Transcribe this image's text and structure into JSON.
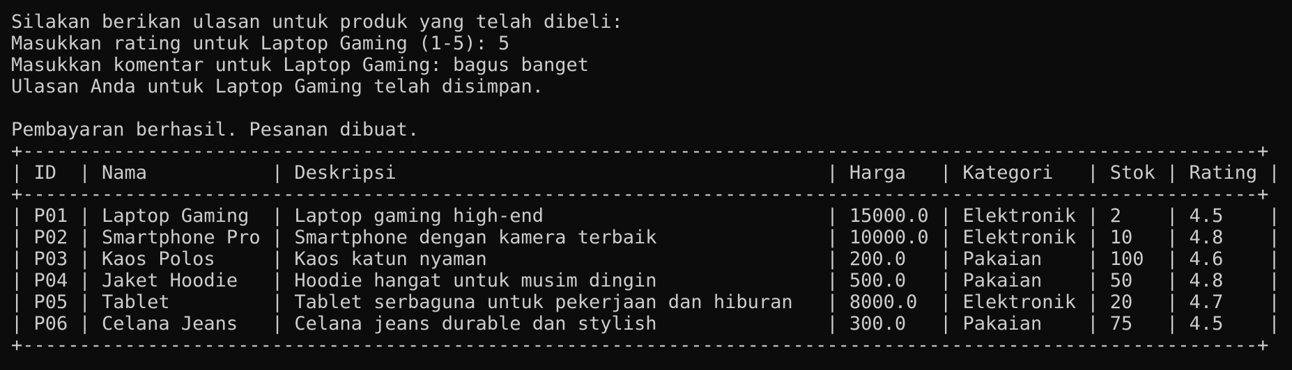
{
  "terminal": {
    "prompt_intro": "Silakan berikan ulasan untuk produk yang telah dibeli:",
    "rating_prompt": "Masukkan rating untuk Laptop Gaming (1-5): 5",
    "comment_prompt": "Masukkan komentar untuk Laptop Gaming: bagus banget",
    "review_saved": "Ulasan Anda untuk Laptop Gaming telah disimpan.",
    "payment_success": "Pembayaran berhasil. Pesanan dibuat."
  },
  "table": {
    "border": "+-------------------------------------------------------------------------------------------------------------+",
    "header": "| ID  | Nama           | Deskripsi                                      | Harga   | Kategori   | Stok | Rating |",
    "rows": [
      "| P01 | Laptop Gaming  | Laptop gaming high-end                         | 15000.0 | Elektronik | 2    | 4.5    |",
      "| P02 | Smartphone Pro | Smartphone dengan kamera terbaik               | 10000.0 | Elektronik | 10   | 4.8    |",
      "| P03 | Kaos Polos     | Kaos katun nyaman                              | 200.0   | Pakaian    | 100  | 4.6    |",
      "| P04 | Jaket Hoodie   | Hoodie hangat untuk musim dingin               | 500.0   | Pakaian    | 50   | 4.8    |",
      "| P05 | Tablet         | Tablet serbaguna untuk pekerjaan dan hiburan   | 8000.0  | Elektronik | 20   | 4.7    |",
      "| P06 | Celana Jeans   | Celana jeans durable dan stylish               | 300.0   | Pakaian    | 75   | 4.5    |"
    ]
  }
}
